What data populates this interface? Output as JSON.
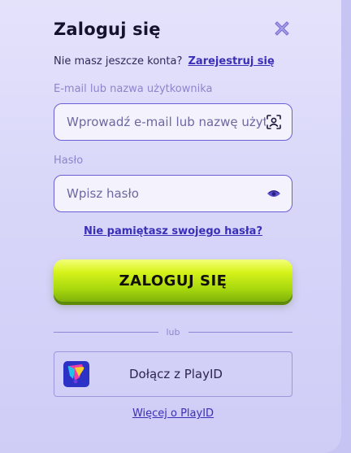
{
  "login": {
    "title": "Zaloguj się",
    "no_account_text": "Nie masz jeszcze konta?",
    "register_link": "Zarejestruj się",
    "email_label": "E-mail lub nazwa użytkownika",
    "email_placeholder": "Wprowadź e-mail lub nazwę użytkownika",
    "email_value": "",
    "password_label": "Hasło",
    "password_placeholder": "Wpisz hasło",
    "password_value": "",
    "forgot_link": "Nie pamiętasz swojego hasła?",
    "submit_label": "ZALOGUJ SIĘ",
    "divider_text": "lub",
    "playid_button_label": "Dołącz z PlayID",
    "more_playid_link": "Więcej o PlayID"
  },
  "icons": {
    "close": "close-icon",
    "scan": "face-scan-icon",
    "password_visibility": "eye-icon",
    "playid_logo": "playid-logo"
  },
  "colors": {
    "accent": "#3b2fb8",
    "submit_button": "#b8e012",
    "panel_background": "#dcdaf9",
    "field_border": "#6b5fd6"
  }
}
